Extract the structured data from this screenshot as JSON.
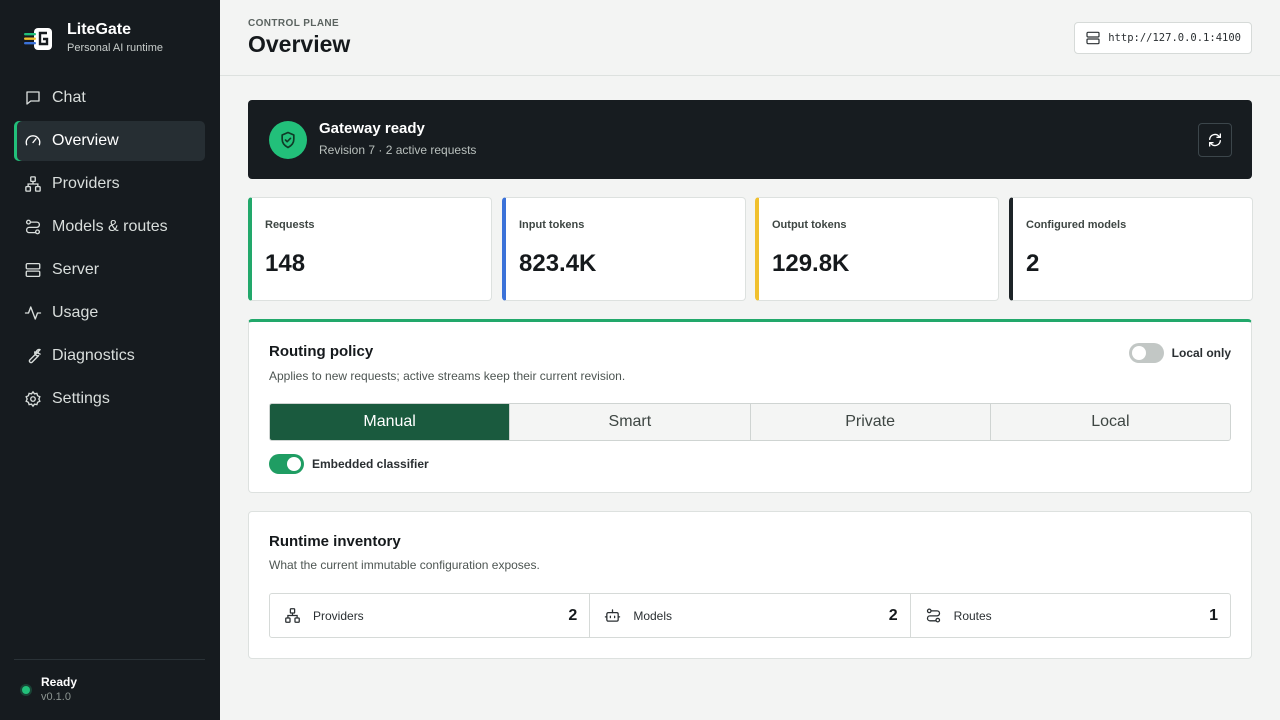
{
  "brand": {
    "name": "LiteGate",
    "tagline": "Personal AI runtime"
  },
  "nav": [
    {
      "label": "Chat",
      "icon": "chat-icon",
      "active": false
    },
    {
      "label": "Overview",
      "icon": "gauge-icon",
      "active": true
    },
    {
      "label": "Providers",
      "icon": "network-icon",
      "active": false
    },
    {
      "label": "Models & routes",
      "icon": "route-icon",
      "active": false
    },
    {
      "label": "Server",
      "icon": "server-icon",
      "active": false
    },
    {
      "label": "Usage",
      "icon": "activity-icon",
      "active": false
    },
    {
      "label": "Diagnostics",
      "icon": "wrench-icon",
      "active": false
    },
    {
      "label": "Settings",
      "icon": "gear-icon",
      "active": false
    }
  ],
  "footer": {
    "status": "Ready",
    "version": "v0.1.0"
  },
  "header": {
    "eyebrow": "CONTROL PLANE",
    "title": "Overview",
    "url": "http://127.0.0.1:4100"
  },
  "gateway": {
    "title": "Gateway ready",
    "subtitle": "Revision 7 · 2 active requests"
  },
  "stats": [
    {
      "label": "Requests",
      "value": "148",
      "color": "#22a86b"
    },
    {
      "label": "Input tokens",
      "value": "823.4K",
      "color": "#3b72d9"
    },
    {
      "label": "Output tokens",
      "value": "129.8K",
      "color": "#f0c02e"
    },
    {
      "label": "Configured models",
      "value": "2",
      "color": "#1d2327"
    }
  ],
  "policy": {
    "title": "Routing policy",
    "subtitle": "Applies to new requests; active streams keep their current revision.",
    "local_only_label": "Local only",
    "local_only": false,
    "modes": [
      "Manual",
      "Smart",
      "Private",
      "Local"
    ],
    "selected_mode": "Manual",
    "classifier_label": "Embedded classifier",
    "classifier": true
  },
  "inventory": {
    "title": "Runtime inventory",
    "subtitle": "What the current immutable configuration exposes.",
    "items": [
      {
        "label": "Providers",
        "count": "2",
        "icon": "network-icon"
      },
      {
        "label": "Models",
        "count": "2",
        "icon": "bot-icon"
      },
      {
        "label": "Routes",
        "count": "1",
        "icon": "route-icon"
      }
    ]
  },
  "colors": {
    "accent": "#22c07a",
    "selected_segment": "#1a5a3e",
    "sidebar": "#161b1f"
  }
}
